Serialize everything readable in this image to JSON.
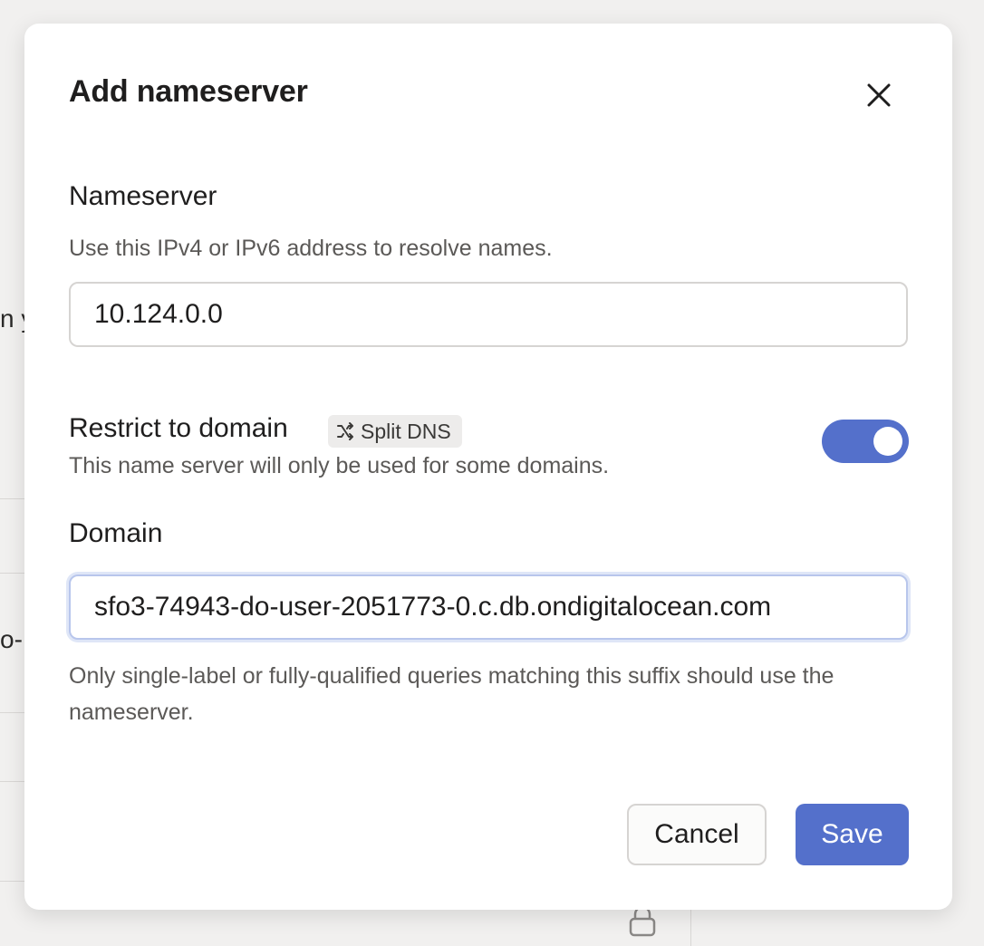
{
  "background": {
    "fragment_1": "n y",
    "fragment_2": "o-"
  },
  "dialog": {
    "title": "Add nameserver",
    "close_icon": "close-icon",
    "nameserver": {
      "label": "Nameserver",
      "help": "Use this IPv4 or IPv6 address to resolve names.",
      "value": "10.124.0.0"
    },
    "restrict": {
      "label": "Restrict to domain",
      "badge_icon": "shuffle-icon",
      "badge_label": "Split DNS",
      "help": "This name server will only be used for some domains.",
      "enabled": true
    },
    "domain": {
      "label": "Domain",
      "value": "sfo3-74943-do-user-2051773-0.c.db.ondigitalocean.com",
      "help": "Only single-label or fully-qualified queries matching this suffix should use the nameserver."
    },
    "buttons": {
      "cancel": "Cancel",
      "save": "Save"
    }
  },
  "colors": {
    "accent": "#5470cb",
    "text": "#1f1e1e",
    "muted_text": "#5b5957",
    "border": "#d6d4d2"
  }
}
